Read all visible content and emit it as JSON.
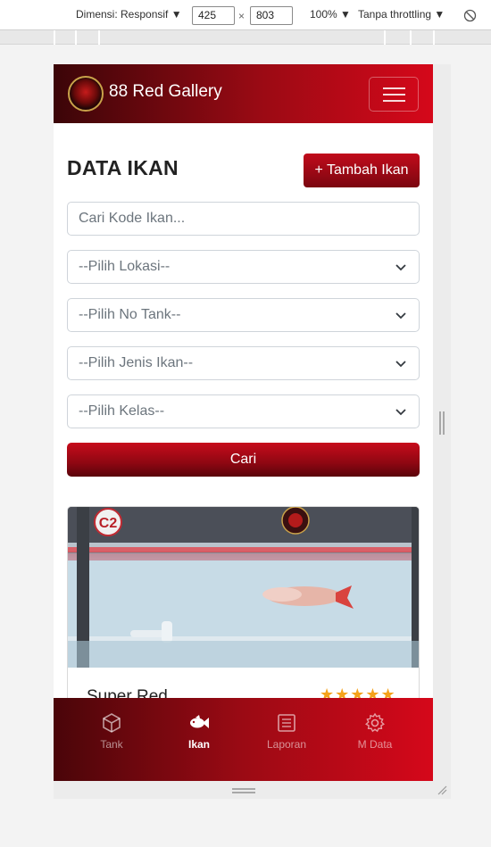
{
  "devtools": {
    "dimension_label": "Dimensi: Responsif ▼",
    "width": "425",
    "height": "803",
    "times": "×",
    "zoom": "100% ▼",
    "throttling": "Tanpa throttling ▼"
  },
  "app": {
    "brand": "88 Red Gallery"
  },
  "page": {
    "title": "DATA IKAN",
    "add_button": "+ Tambah Ikan"
  },
  "filters": {
    "search_placeholder": "Cari Kode Ikan...",
    "location": "--Pilih Lokasi--",
    "tank": "--Pilih No Tank--",
    "fish_type": "--Pilih Jenis Ikan--",
    "grade": "--Pilih Kelas--",
    "search_button": "Cari"
  },
  "fish_card": {
    "name": "Super Red",
    "rating": 5,
    "stars": "★★★★★",
    "photo_tank_label": "C2"
  },
  "bottom_nav": {
    "items": [
      {
        "label": "Tank",
        "icon": "box-icon",
        "active": false
      },
      {
        "label": "Ikan",
        "icon": "fish-icon",
        "active": true
      },
      {
        "label": "Laporan",
        "icon": "report-icon",
        "active": false
      },
      {
        "label": "M Data",
        "icon": "gear-icon",
        "active": false
      }
    ]
  },
  "colors": {
    "brand_dark": "#3b0508",
    "brand_red": "#d5081a",
    "star": "#f5a21b"
  }
}
